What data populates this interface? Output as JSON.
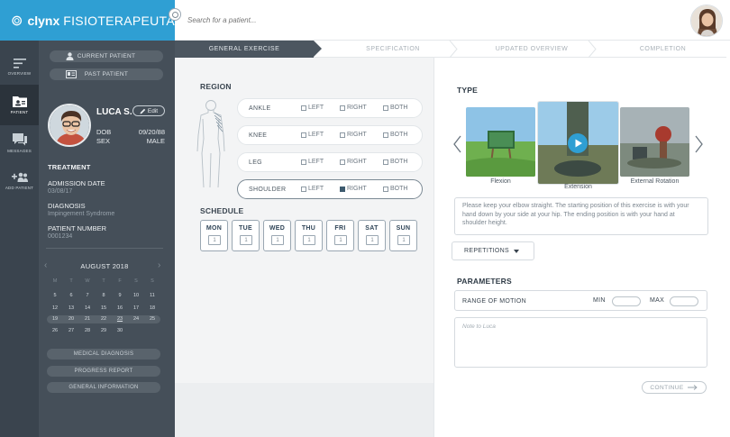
{
  "brand": {
    "name_bold": "clynx",
    "name_rest": "FISIOTERAPEUTA"
  },
  "search": {
    "placeholder": "Search for a patient..."
  },
  "rail": [
    {
      "label": "OVERVIEW",
      "icon": "overview-icon"
    },
    {
      "label": "PATIENT",
      "icon": "patient-folder-icon"
    },
    {
      "label": "MESSAGES",
      "icon": "messages-icon"
    },
    {
      "label": "ADD PATIENT",
      "icon": "add-patient-icon"
    }
  ],
  "sidebar": {
    "current_patient": "CURRENT PATIENT",
    "past_patient": "PAST PATIENT",
    "patient": {
      "name": "LUCA S.",
      "edit": "Edit",
      "dob_label": "DOB",
      "dob": "09/20/88",
      "sex_label": "SEX",
      "sex": "MALE"
    },
    "treatment_title": "TREATMENT",
    "admission_label": "ADMISSION DATE",
    "admission": "03/08/17",
    "diagnosis_label": "DIAGNOSIS",
    "diagnosis": "Impingement Syndrome",
    "number_label": "PATIENT NUMBER",
    "number": "0001234",
    "calendar": {
      "month": "AUGUST 2018",
      "prev": "‹",
      "next": "›",
      "weekdays": [
        "M",
        "T",
        "W",
        "T",
        "F",
        "S",
        "S"
      ],
      "weeks": [
        [
          "5",
          "6",
          "7",
          "8",
          "9",
          "10",
          "11"
        ],
        [
          "12",
          "13",
          "14",
          "15",
          "16",
          "17",
          "18"
        ],
        [
          "19",
          "20",
          "21",
          "22",
          "23",
          "24",
          "25"
        ],
        [
          "26",
          "27",
          "28",
          "29",
          "30",
          "",
          ""
        ]
      ]
    },
    "buttons": [
      "MEDICAL DIAGNOSIS",
      "PROGRESS REPORT",
      "GENERAL INFORMATION"
    ]
  },
  "steps": [
    "GENERAL EXERCISE",
    "SPECIFICATION",
    "UPDATED OVERVIEW",
    "COMPLETION"
  ],
  "region": {
    "title": "REGION",
    "rows": [
      {
        "name": "ANKLE",
        "left": false,
        "right": false,
        "both": false
      },
      {
        "name": "KNEE",
        "left": false,
        "right": false,
        "both": false
      },
      {
        "name": "LEG",
        "left": false,
        "right": false,
        "both": false
      },
      {
        "name": "SHOULDER",
        "left": false,
        "right": true,
        "both": false
      }
    ],
    "opt_left": "LEFT",
    "opt_right": "RIGHT",
    "opt_both": "BOTH"
  },
  "schedule": {
    "title": "SCHEDULE",
    "days": [
      {
        "label": "MON",
        "value": "1"
      },
      {
        "label": "TUE",
        "value": "1"
      },
      {
        "label": "WED",
        "value": "1"
      },
      {
        "label": "THU",
        "value": "1"
      },
      {
        "label": "FRI",
        "value": "1"
      },
      {
        "label": "SAT",
        "value": "1"
      },
      {
        "label": "SUN",
        "value": "1"
      }
    ]
  },
  "type": {
    "title": "TYPE",
    "exercises": [
      "Flexion",
      "Extension",
      "External Rotation"
    ],
    "description": "Please keep your elbow straight. The starting position of this exercise is with your hand down by your side at your hip. The ending position is with your hand at shoulder height.",
    "repetitions": "REPETITIONS"
  },
  "parameters": {
    "title": "PARAMETERS",
    "rom_label": "RANGE OF MOTION",
    "min_label": "MIN",
    "max_label": "MAX",
    "note_placeholder": "Note to Luca",
    "continue": "CONTINUE"
  },
  "colors": {
    "brand": "#2f9fd3",
    "sidebar": "#454f59",
    "rail": "#3a444e",
    "active_step": "#4c5660"
  }
}
